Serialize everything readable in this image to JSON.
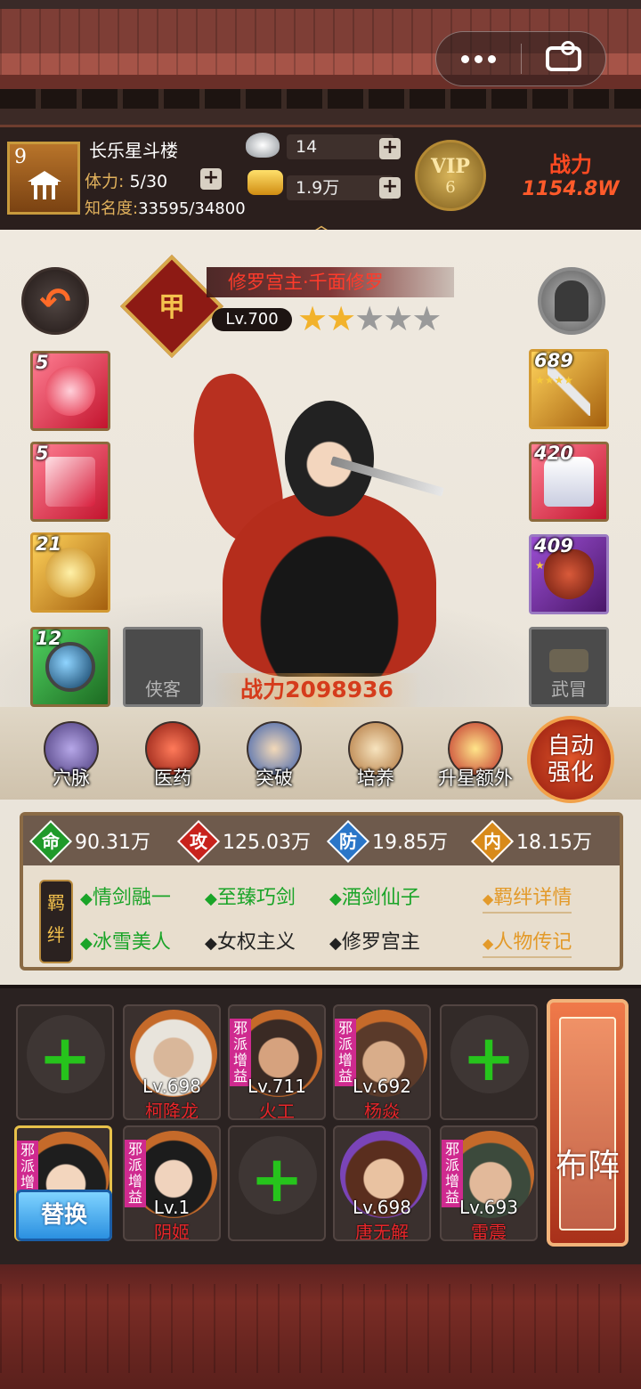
{
  "miniprogram": {
    "more_icon": "more-dots-icon",
    "game_icon": "gamepad-icon"
  },
  "header": {
    "building_level": "9",
    "building_name": "长乐星斗楼",
    "stamina_label": "体力:",
    "stamina_value": "5/30",
    "fame_label": "知名度:",
    "fame_value": "33595/34800",
    "silver": "14",
    "gold": "1.9万",
    "vip_label": "VIP",
    "vip_level": "6",
    "power_label": "战力",
    "power_value": "1154.8W"
  },
  "hero": {
    "rank_badge": "甲",
    "title": "修罗宫主·千面修罗",
    "level": "Lv.700",
    "stars_filled": 2,
    "stars_total": 5,
    "power": "战力2098936"
  },
  "left_slots": [
    {
      "count": "5",
      "color": "red"
    },
    {
      "count": "5",
      "color": "red"
    },
    {
      "count": "21",
      "color": "gold"
    },
    {
      "count": "12",
      "color": "green"
    }
  ],
  "right_slots": [
    {
      "count": "689",
      "color": "gold"
    },
    {
      "count": "420",
      "color": "red"
    },
    {
      "count": "409",
      "color": "purple"
    }
  ],
  "empty_slots": {
    "companion": "侠客",
    "weapon": "武冒"
  },
  "functions": [
    "穴脉",
    "医药",
    "突破",
    "培养",
    "升星额外"
  ],
  "auto_enhance": [
    "自动",
    "强化"
  ],
  "stats": [
    {
      "icon": "命",
      "value": "90.31万",
      "color": "#1f9a2a"
    },
    {
      "icon": "攻",
      "value": "125.03万",
      "color": "#c8221c"
    },
    {
      "icon": "防",
      "value": "19.85万",
      "color": "#2a76c8"
    },
    {
      "icon": "内",
      "value": "18.15万",
      "color": "#d88a1a"
    }
  ],
  "bonds": {
    "seal": [
      "羁",
      "绊"
    ],
    "row1": [
      {
        "text": "情剑融一",
        "active": true
      },
      {
        "text": "至臻巧剑",
        "active": true
      },
      {
        "text": "酒剑仙子",
        "active": true
      }
    ],
    "row2": [
      {
        "text": "冰雪美人",
        "active": true
      },
      {
        "text": "女权主义",
        "active": false
      },
      {
        "text": "修罗宫主",
        "active": false
      }
    ],
    "details_link": "羁绊详情",
    "bio_link": "人物传记"
  },
  "team": {
    "row1": [
      {
        "empty": true
      },
      {
        "level": "Lv.698",
        "name": "柯降龙",
        "tag": ""
      },
      {
        "level": "Lv.711",
        "name": "火工",
        "tag": "邪派增益"
      },
      {
        "level": "Lv.692",
        "name": "杨焱",
        "tag": "邪派增益"
      },
      {
        "empty": true
      }
    ],
    "row2": [
      {
        "level": "",
        "name": "",
        "tag": "邪派增益",
        "selected": true
      },
      {
        "level": "Lv.1",
        "name": "阴姬",
        "tag": "邪派增益"
      },
      {
        "empty": true
      },
      {
        "level": "Lv.698",
        "name": "唐无解",
        "tag": ""
      },
      {
        "level": "Lv.693",
        "name": "雷震",
        "tag": "邪派增益"
      }
    ],
    "swap_label": "替换",
    "formation_label": "布阵"
  },
  "colors": {
    "accent_red": "#e8262a",
    "bond_active": "#1aa428",
    "link_gold": "#e39a2a"
  }
}
